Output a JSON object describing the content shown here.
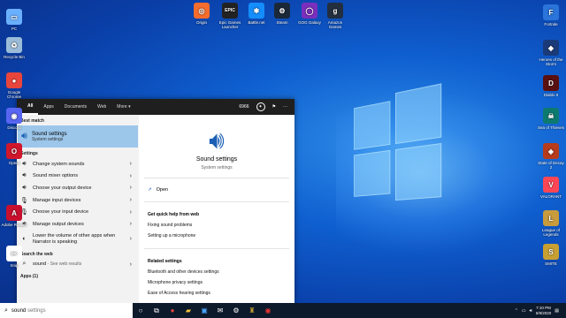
{
  "desktop": {
    "icons_left": [
      {
        "label": "PC",
        "color": "#6ab0ff",
        "glyph": "▭"
      },
      {
        "label": "Recycle Bin",
        "color": "#9bbcd8",
        "glyph": "♻"
      },
      {
        "label": "Google Chrome",
        "color": "#e8453c",
        "glyph": "●"
      },
      {
        "label": "Discord",
        "color": "#5865f2",
        "glyph": "◉"
      },
      {
        "label": "Opera",
        "color": "#d1172c",
        "glyph": "O"
      },
      {
        "label": "Adobe Reader",
        "color": "#c8102e",
        "glyph": "A"
      },
      {
        "label": "Snip",
        "color": "#ffffff",
        "glyph": "✂"
      }
    ],
    "icons_top": [
      {
        "label": "Origin",
        "color": "#f56c2d",
        "glyph": "◎"
      },
      {
        "label": "Epic Games Launcher",
        "color": "#222222",
        "glyph": "EPIC"
      },
      {
        "label": "Battle.net",
        "color": "#148eff",
        "glyph": "✱"
      },
      {
        "label": "Steam",
        "color": "#1b2838",
        "glyph": "⚙"
      },
      {
        "label": "GOG Galaxy",
        "color": "#7b2fbe",
        "glyph": "◯"
      },
      {
        "label": "Amazon Games",
        "color": "#232f3e",
        "glyph": "g"
      }
    ],
    "icons_right": [
      {
        "label": "Fortnite",
        "color": "#2b74d9",
        "glyph": "F"
      },
      {
        "label": "Heroes of the Storm",
        "color": "#1a3a7a",
        "glyph": "◆"
      },
      {
        "label": "Diablo II",
        "color": "#5a1010",
        "glyph": "D"
      },
      {
        "label": "Sea of Thieves",
        "color": "#0c7a6f",
        "glyph": "☠"
      },
      {
        "label": "State of Decay 2",
        "color": "#b83b1c",
        "glyph": "◈"
      },
      {
        "label": "VALORANT",
        "color": "#ff4655",
        "glyph": "V"
      },
      {
        "label": "League of Legends",
        "color": "#c89b3c",
        "glyph": "L"
      },
      {
        "label": "SMITE",
        "color": "#c8a032",
        "glyph": "S"
      }
    ]
  },
  "start": {
    "tabs": [
      "All",
      "Apps",
      "Documents",
      "Web",
      "More"
    ],
    "points": "6966",
    "best_match_header": "Best match",
    "best_match": {
      "title": "Sound settings",
      "subtitle": "System settings"
    },
    "settings_header": "Settings",
    "settings": [
      "Change system sounds",
      "Sound mixer options",
      "Choose your output device",
      "Manage input devices",
      "Choose your input device",
      "Manage output devices",
      "Lower the volume of other apps when Narrator is speaking"
    ],
    "web_header": "Search the web",
    "web_query": "sound",
    "web_suffix": " - See web results",
    "apps_header": "Apps (1)",
    "right": {
      "title": "Sound settings",
      "subtitle": "System settings",
      "open": "Open",
      "quick_help_header": "Get quick help from web",
      "quick_help": [
        "Fixing sound problems",
        "Setting up a microphone"
      ],
      "related_header": "Related settings",
      "related": [
        "Bluetooth and other devices settings",
        "Microphone privacy settings",
        "Ease of Access hearing settings"
      ]
    }
  },
  "taskbar": {
    "search_text": "sound",
    "search_placeholder": " settings",
    "time": "7:10 PM",
    "date": "5/9/2020"
  }
}
